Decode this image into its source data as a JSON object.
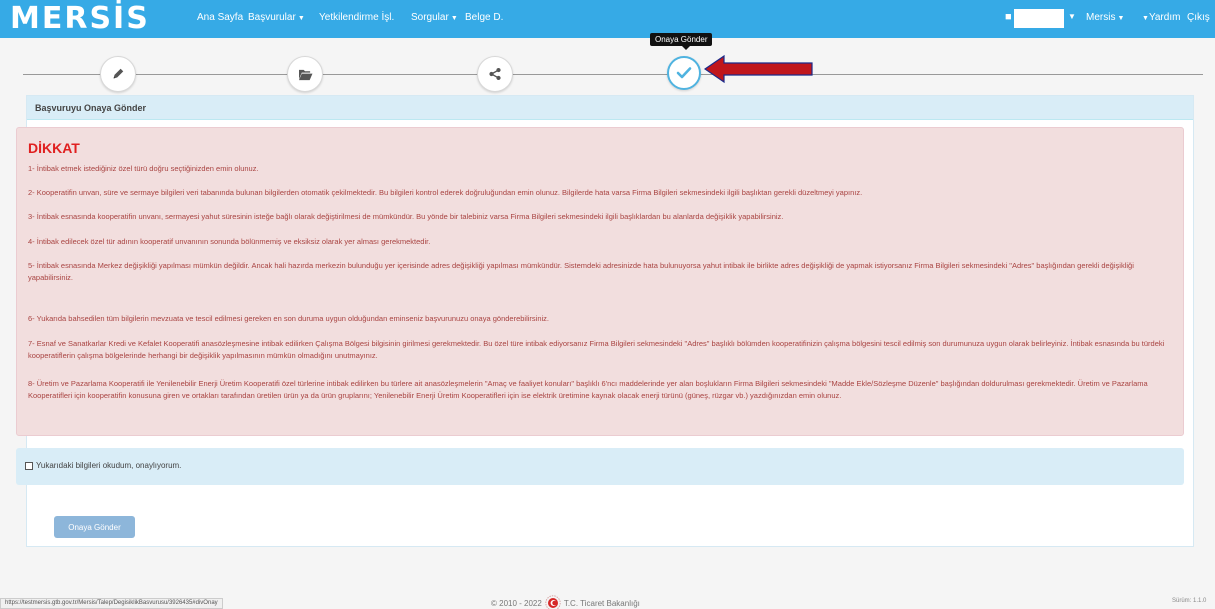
{
  "navbar": {
    "logo": "MERSİS",
    "items": [
      "Ana Sayfa",
      "Başvurular",
      "Yetkilendirme İşl.",
      "Sorgular",
      "Belge D."
    ],
    "right_items": [
      "Mersis",
      "Yardım",
      "Çıkış"
    ]
  },
  "wizard": {
    "tooltip": "Onaya Gönder",
    "steps": [
      "pencil-icon",
      "folder-icon",
      "share-icon",
      "check-icon"
    ],
    "active_step": 4
  },
  "panel": {
    "heading": "Başvuruyu Onaya Gönder",
    "alert_title": "DİKKAT",
    "items": [
      "1- İntibak etmek istediğiniz özel türü doğru seçtiğinizden emin olunuz.",
      "2- Kooperatifin unvan, süre ve sermaye bilgileri veri tabanında bulunan bilgilerden otomatik çekilmektedir. Bu bilgileri kontrol ederek doğruluğundan emin olunuz. Bilgilerde hata varsa Firma Bilgileri sekmesindeki ilgili başlıktan gerekli düzeltmeyi yapınız.",
      "3- İntibak esnasında kooperatifin unvanı, sermayesi yahut süresinin isteğe bağlı olarak değiştirilmesi de mümkündür. Bu yönde bir talebiniz varsa Firma Bilgileri sekmesindeki ilgili başlıklardan bu alanlarda değişiklik yapabilirsiniz.",
      "4- İntibak edilecek özel tür adının kooperatif unvanının sonunda bölünmemiş ve eksiksiz olarak yer alması gerekmektedir.",
      "5- İntibak esnasında Merkez değişikliği yapılması mümkün değildir. Ancak hali hazırda merkezin bulunduğu yer içerisinde adres değişikliği yapılması mümkündür. Sistemdeki adresinizde hata bulunuyorsa yahut intibak ile birlikte adres değişikliği de yapmak istiyorsanız Firma Bilgileri sekmesindeki \"Adres\" başlığından gerekli değişikliği yapabilirsiniz.",
      "6- Yukarıda bahsedilen tüm bilgilerin mevzuata ve tescil edilmesi gereken en son duruma uygun olduğundan eminseniz başvurunuzu onaya gönderebilirsiniz.",
      "7- Esnaf ve Sanatkarlar Kredi ve Kefalet Kooperatifi anasözleşmesine intibak edilirken Çalışma Bölgesi bilgisinin girilmesi gerekmektedir. Bu özel türe intibak ediyorsanız Firma Bilgileri sekmesindeki \"Adres\" başlıklı bölümden kooperatifinizin çalışma bölgesini tescil edilmiş son durumunuza uygun olarak belirleyiniz. İntibak esnasında bu türdeki kooperatiflerin çalışma bölgelerinde herhangi bir değişiklik yapılmasının mümkün olmadığını unutmayınız.",
      "8- Üretim ve Pazarlama Kooperatifi ile Yenilenebilir Enerji Üretim Kooperatifi özel türlerine intibak edilirken bu türlere ait anasözleşmelerin \"Amaç ve faaliyet konuları\" başlıklı 6'ncı maddelerinde yer alan boşlukların Firma Bilgileri sekmesindeki \"Madde Ekle/Sözleşme Düzenle\" başlığından doldurulması gerekmektedir. Üretim ve Pazarlama Kooperatifleri için kooperatifin konusuna giren ve ortakları tarafından üretilen ürün ya da ürün gruplarını; Yenilenebilir Enerji Üretim Kooperatifleri için ise elektrik üretimine kaynak olacak enerji türünü (güneş, rüzgar vb.) yazdığınızdan emin olunuz."
    ],
    "confirm_label": "Yukarıdaki bilgileri okudum, onaylıyorum.",
    "submit_label": "Onaya Gönder"
  },
  "footer": {
    "status_url": "https://testmersis.gtb.gov.tr/Mersis/Talep/DegisiklikBasvurusu/3926435#divOnay",
    "copyright": "© 2010 - 2022",
    "ministry": "T.C. Ticaret Bakanlığı",
    "version": "Sürüm: 1.1.0"
  },
  "colors": {
    "navbar": "#36aae6",
    "alert_bg": "#f2dede",
    "alert_text": "#a94442",
    "title_red": "#e02020",
    "info_bg": "#d9edf7",
    "button": "#8db6da"
  }
}
